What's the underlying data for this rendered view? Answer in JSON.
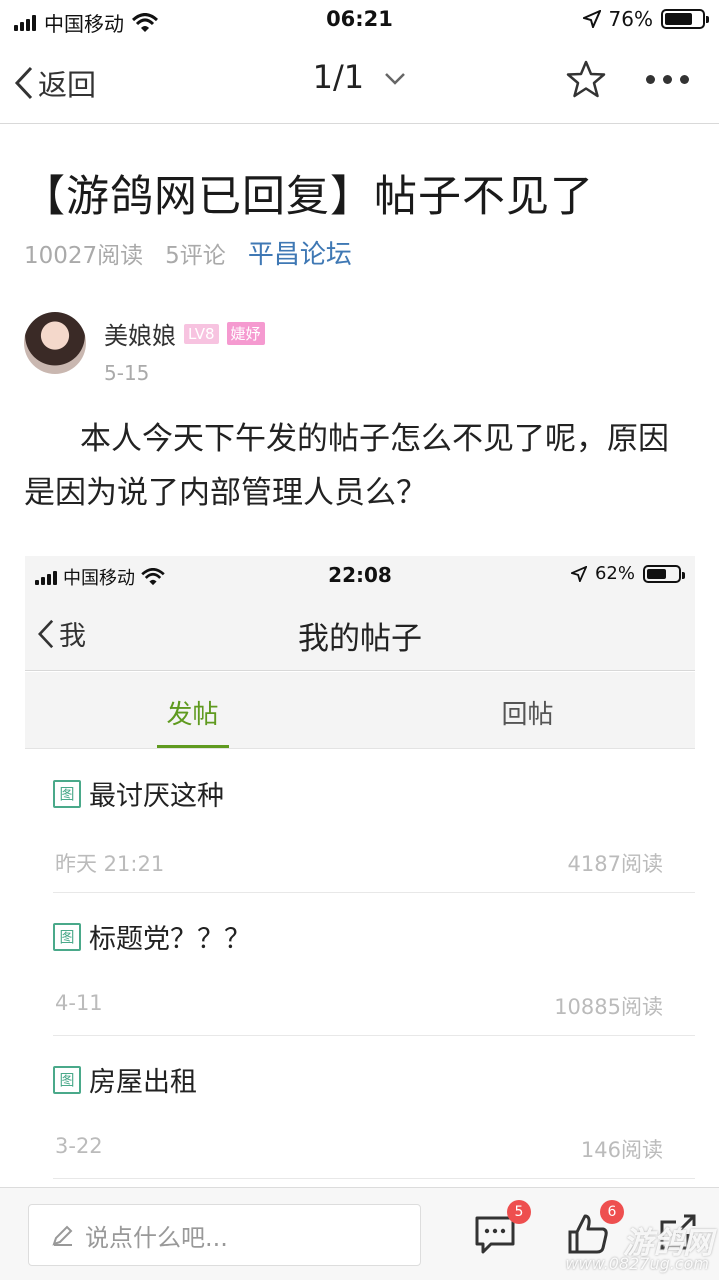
{
  "status_bar": {
    "carrier": "中国移动",
    "time": "06:21",
    "battery": "76%",
    "battery_level": 0.76
  },
  "nav": {
    "back_label": "返回",
    "page_indicator": "1/1"
  },
  "article": {
    "title": "【游鸽网已回复】帖子不见了",
    "reads": "10027阅读",
    "comments": "5评论",
    "forum": "平昌论坛",
    "author": {
      "name": "美娘娘",
      "level_tag": "LV8",
      "honor_tag": "婕妤",
      "date": "5-15"
    },
    "body": "本人今天下午发的帖子怎么不见了呢，原因是因为说了内部管理人员么？"
  },
  "embedded_screenshot": {
    "status_bar": {
      "carrier": "中国移动",
      "time": "22:08",
      "battery": "62%",
      "battery_level": 0.62
    },
    "nav": {
      "back_label": "我",
      "title": "我的帖子"
    },
    "tabs": [
      {
        "label": "发帖",
        "active": true
      },
      {
        "label": "回帖",
        "active": false
      }
    ],
    "posts": [
      {
        "tag": "图",
        "title": "最讨厌这种",
        "date": "昨天 21:21",
        "reads": "4187阅读"
      },
      {
        "tag": "图",
        "title": "标题党？？？",
        "date": "4-11",
        "reads": "10885阅读"
      },
      {
        "tag": "图",
        "title": "房屋出租",
        "date": "3-22",
        "reads": "146阅读"
      }
    ]
  },
  "bottom_bar": {
    "comment_placeholder": "说点什么吧...",
    "comment_count": "5",
    "like_count": "6"
  },
  "watermark": {
    "text": "游鸽网",
    "url": "www.0827ug.com"
  },
  "colors": {
    "forum_link": "#3f78b4",
    "tab_active": "#5f9a1f",
    "image_tag": "#4aa98a",
    "badge": "#ee4f4f",
    "level_tag": "#f7c3e0",
    "honor_tag": "#f59ad0"
  }
}
